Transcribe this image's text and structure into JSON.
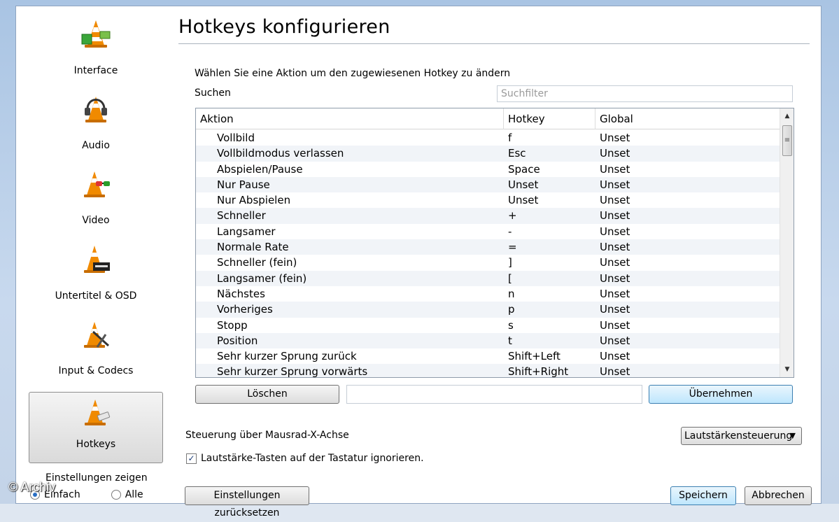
{
  "sidebar": {
    "items": [
      {
        "label": "Interface",
        "icon": "cone-interface-icon"
      },
      {
        "label": "Audio",
        "icon": "cone-headphones-icon"
      },
      {
        "label": "Video",
        "icon": "cone-glasses-icon"
      },
      {
        "label": "Untertitel & OSD",
        "icon": "cone-subtitle-icon"
      },
      {
        "label": "Input & Codecs",
        "icon": "cone-input-icon"
      },
      {
        "label": "Hotkeys",
        "icon": "cone-hotkeys-icon"
      }
    ],
    "selected": "Hotkeys",
    "show_settings_label": "Einstellungen zeigen",
    "radio_simple": "Einfach",
    "radio_all": "Alle"
  },
  "watermark": "© Archiv",
  "main": {
    "title": "Hotkeys konfigurieren",
    "intro": "Wählen Sie eine Aktion um den zugewiesenen Hotkey zu ändern",
    "search_label": "Suchen",
    "search_placeholder": "Suchfilter",
    "table": {
      "headers": [
        "Aktion",
        "Hotkey",
        "Global"
      ],
      "rows": [
        [
          "Vollbild",
          "f",
          "Unset"
        ],
        [
          "Vollbildmodus verlassen",
          "Esc",
          "Unset"
        ],
        [
          "Abspielen/Pause",
          "Space",
          "Unset"
        ],
        [
          "Nur Pause",
          "Unset",
          "Unset"
        ],
        [
          "Nur Abspielen",
          "Unset",
          "Unset"
        ],
        [
          "Schneller",
          "+",
          "Unset"
        ],
        [
          "Langsamer",
          "-",
          "Unset"
        ],
        [
          "Normale Rate",
          "=",
          "Unset"
        ],
        [
          "Schneller (fein)",
          "]",
          "Unset"
        ],
        [
          "Langsamer (fein)",
          "[",
          "Unset"
        ],
        [
          "Nächstes",
          "n",
          "Unset"
        ],
        [
          "Vorheriges",
          "p",
          "Unset"
        ],
        [
          "Stopp",
          "s",
          "Unset"
        ],
        [
          "Position",
          "t",
          "Unset"
        ],
        [
          "Sehr kurzer Sprung zurück",
          "Shift+Left",
          "Unset"
        ],
        [
          "Sehr kurzer Sprung vorwärts",
          "Shift+Right",
          "Unset"
        ]
      ]
    },
    "delete_button": "Löschen",
    "hotkey_field_value": "",
    "apply_button": "Übernehmen",
    "mouse_wheel_label": "Steuerung über Mausrad-X-Achse",
    "mouse_wheel_selected": "Lautstärkensteuerung",
    "ignore_volume_keys_label": "Lautstärke-Tasten auf der Tastatur ignorieren.",
    "ignore_volume_keys_checked": true
  },
  "footer": {
    "reset_button": "Einstellungen zurücksetzen",
    "save_button": "Speichern",
    "cancel_button": "Abbrechen"
  }
}
